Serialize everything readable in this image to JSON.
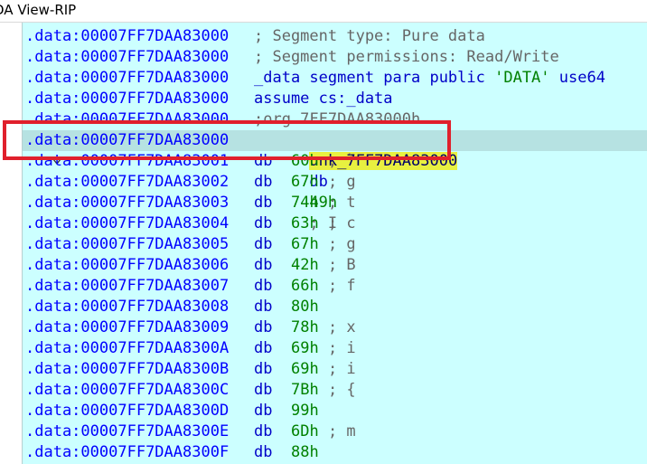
{
  "window": {
    "title": "DA View-RIP"
  },
  "listing": {
    "segment_prefix": ".data:",
    "lines": [
      {
        "address": "00007FF7DAA83000",
        "text": "; Segment type: Pure data"
      },
      {
        "address": "00007FF7DAA83000",
        "text": "; Segment permissions: Read/Write"
      },
      {
        "address": "00007FF7DAA83000",
        "text_kw": "_data segment para public ",
        "text_str": "'DATA'",
        "text_kw2": " use64"
      },
      {
        "address": "00007FF7DAA83000",
        "text": "assume cs:_data"
      },
      {
        "address": "00007FF7DAA83000",
        "text": ";org 7FF7DAA83000h"
      },
      {
        "address": "00007FF7DAA83000",
        "label": "unk_7FF7DAA83000",
        "mnem": "db",
        "value": "49h",
        "comment": "; I"
      },
      {
        "address": "00007FF7DAA83001",
        "mnem": "db",
        "value": "60h",
        "comment": "; `"
      },
      {
        "address": "00007FF7DAA83002",
        "mnem": "db",
        "value": "67h",
        "comment": "; g"
      },
      {
        "address": "00007FF7DAA83003",
        "mnem": "db",
        "value": "74h",
        "comment": "; t"
      },
      {
        "address": "00007FF7DAA83004",
        "mnem": "db",
        "value": "63h",
        "comment": "; c"
      },
      {
        "address": "00007FF7DAA83005",
        "mnem": "db",
        "value": "67h",
        "comment": "; g"
      },
      {
        "address": "00007FF7DAA83006",
        "mnem": "db",
        "value": "42h",
        "comment": "; B"
      },
      {
        "address": "00007FF7DAA83007",
        "mnem": "db",
        "value": "66h",
        "comment": "; f"
      },
      {
        "address": "00007FF7DAA83008",
        "mnem": "db",
        "value": "80h",
        "comment": ""
      },
      {
        "address": "00007FF7DAA83009",
        "mnem": "db",
        "value": "78h",
        "comment": "; x"
      },
      {
        "address": "00007FF7DAA8300A",
        "mnem": "db",
        "value": "69h",
        "comment": "; i"
      },
      {
        "address": "00007FF7DAA8300B",
        "mnem": "db",
        "value": "69h",
        "comment": "; i"
      },
      {
        "address": "00007FF7DAA8300C",
        "mnem": "db",
        "value": "7Bh",
        "comment": "; {"
      },
      {
        "address": "00007FF7DAA8300D",
        "mnem": "db",
        "value": "99h",
        "comment": ""
      },
      {
        "address": "00007FF7DAA8300E",
        "mnem": "db",
        "value": "6Dh",
        "comment": "; m"
      },
      {
        "address": "00007FF7DAA8300F",
        "mnem": "db",
        "value": "88h",
        "comment": ""
      }
    ]
  },
  "colors": {
    "listing_bg": "#ccffff",
    "address": "#0000ff",
    "current_line": "#b6e2e2",
    "highlight": "#e8f040",
    "annotation": "#e0202c"
  },
  "icons": {
    "collapse": "chevron-down-icon"
  }
}
